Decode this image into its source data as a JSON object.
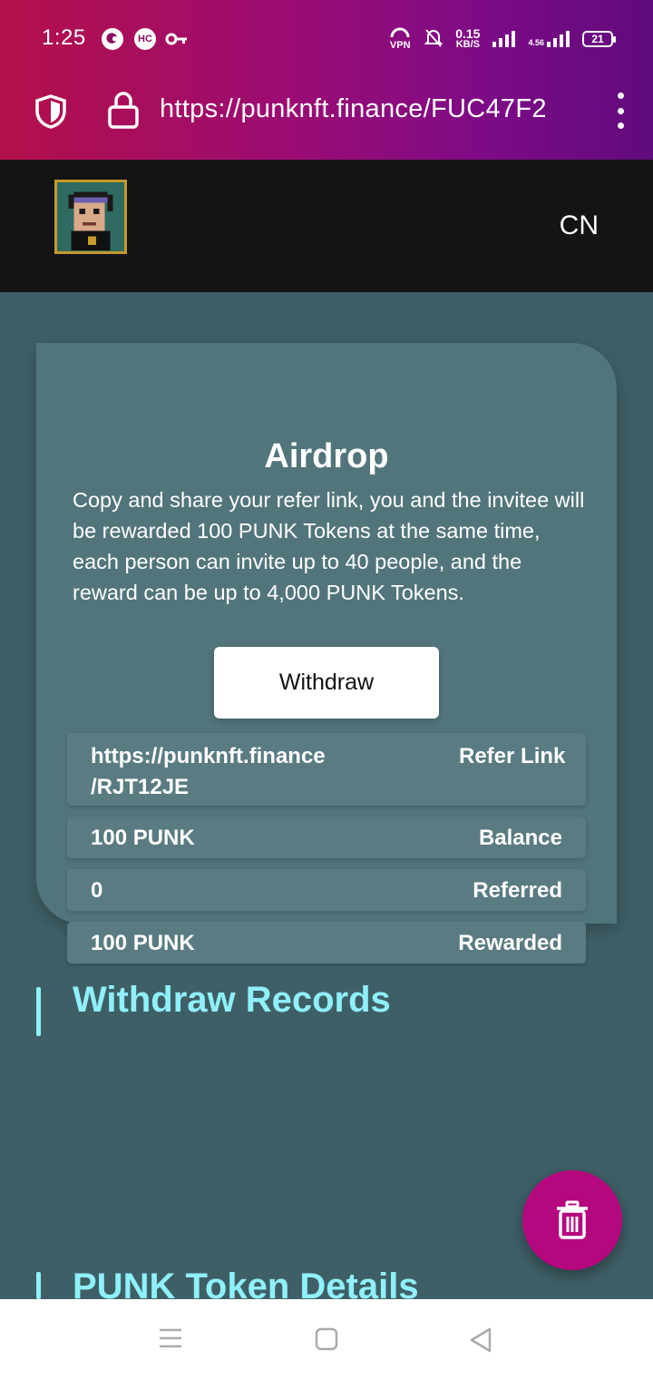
{
  "status": {
    "time": "1:25",
    "icons": [
      "firefox-icon",
      "hc-icon",
      "key-icon"
    ],
    "hc_label": "HC",
    "vpn_label": "VPN",
    "net_speed_value": "0.15",
    "net_speed_unit": "KB/S",
    "network_label": "4.56",
    "battery": "21"
  },
  "browser": {
    "url": "https://punknft.finance/FUC47F2"
  },
  "header": {
    "language": "CN"
  },
  "airdrop": {
    "title": "Airdrop",
    "description": "Copy and share your refer link, you and the invitee will be rewarded 100 PUNK Tokens at the same time, each person can invite up to 40 people, and the reward can be up to 4,000 PUNK Tokens.",
    "withdraw_label": "Withdraw",
    "rows": [
      {
        "value": "https://punknft.finance /RJT12JE",
        "label": "Refer Link"
      },
      {
        "value": "100 PUNK",
        "label": "Balance"
      },
      {
        "value": "0",
        "label": "Referred"
      },
      {
        "value": "100 PUNK",
        "label": "Rewarded"
      }
    ]
  },
  "sections": {
    "withdraw_records": "Withdraw Records",
    "token_details": "PUNK Token Details"
  },
  "colors": {
    "accent": "#8ff0fa",
    "fab": "#b5087e",
    "background": "#3f5f66",
    "card": "#52757b"
  }
}
